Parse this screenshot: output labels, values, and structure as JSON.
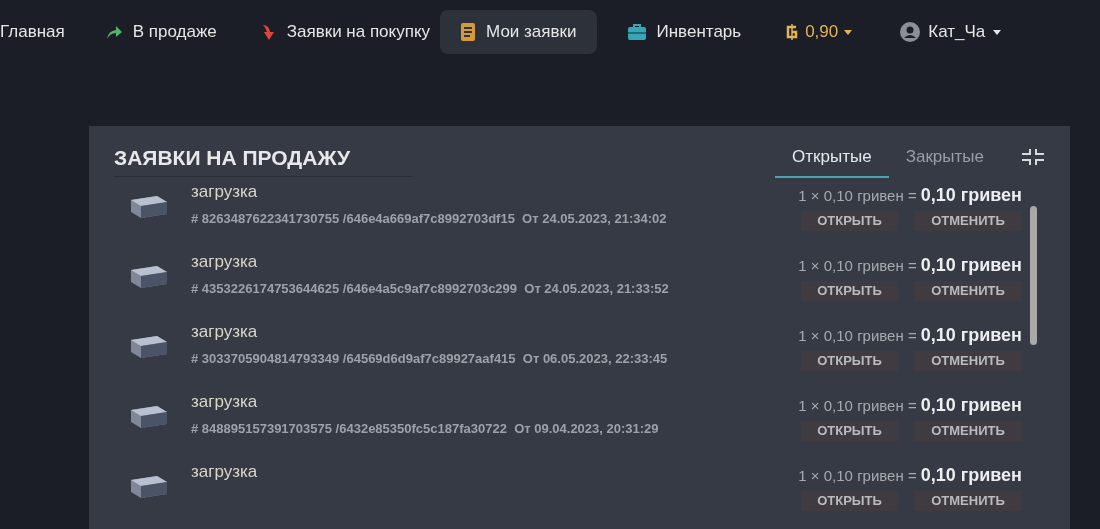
{
  "nav": {
    "items": [
      {
        "label": "Главная",
        "selected": false
      },
      {
        "label": "В продаже",
        "selected": false
      },
      {
        "label": "Заявки на покупку",
        "selected": false
      },
      {
        "label": "Мои заявки",
        "selected": true
      },
      {
        "label": "Инвентарь",
        "selected": false
      }
    ],
    "balance": "0,90",
    "user": "Кат_Ча"
  },
  "panel": {
    "title": "ЗАЯВКИ НА ПРОДАЖУ",
    "tabs": [
      {
        "label": "Открытые",
        "selected": true
      },
      {
        "label": "Закрытые",
        "selected": false
      }
    ],
    "orders": [
      {
        "name": "загрузка",
        "meta": "# 8263487622341730755 /646e4a669af7c8992703df15  От 24.05.2023, 21:34:02",
        "calc": "1 × 0,10 гривен =",
        "total": "0,10 гривен",
        "buttons": [
          "ОТКРЫТЬ",
          "ОТМЕНИТЬ"
        ]
      },
      {
        "name": "загрузка",
        "meta": "# 4353226174753644625 /646e4a5c9af7c8992703c299  От 24.05.2023, 21:33:52",
        "calc": "1 × 0,10 гривен =",
        "total": "0,10 гривен",
        "buttons": [
          "ОТКРЫТЬ",
          "ОТМЕНИТЬ"
        ]
      },
      {
        "name": "загрузка",
        "meta": "# 3033705904814793349 /64569d6d9af7c89927aaf415  От 06.05.2023, 22:33:45",
        "calc": "1 × 0,10 гривен =",
        "total": "0,10 гривен",
        "buttons": [
          "ОТКРЫТЬ",
          "ОТМЕНИТЬ"
        ]
      },
      {
        "name": "загрузка",
        "meta": "# 848895157391703575 /6432e85350fc5c187fa30722  От 09.04.2023, 20:31:29",
        "calc": "1 × 0,10 гривен =",
        "total": "0,10 гривен",
        "buttons": [
          "ОТКРЫТЬ",
          "ОТМЕНИТЬ"
        ]
      },
      {
        "name": "загрузка",
        "calc": "1 × 0,10 гривен =",
        "total": "0,10 гривен",
        "buttons": [
          "ОТКРЫТЬ",
          "ОТМЕНИТЬ"
        ]
      }
    ]
  }
}
